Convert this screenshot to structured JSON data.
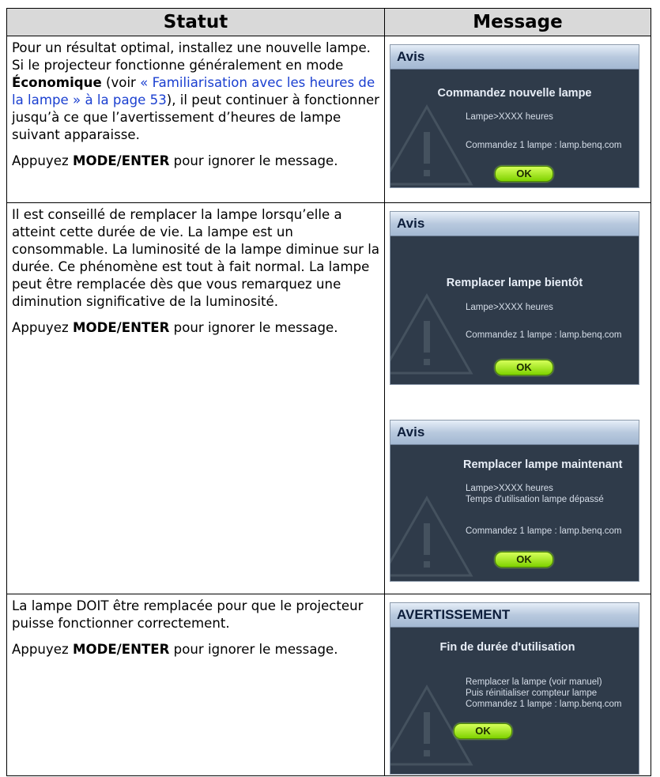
{
  "table": {
    "header_status": "Statut",
    "header_message": "Message"
  },
  "rows": [
    {
      "p1_a": "Pour un résultat optimal, installez une nouvelle lampe. Si le projecteur fonctionne généralement en mode ",
      "p1_bold": "Économique",
      "p1_b": " (voir ",
      "p1_link": "« Familiarisation avec les heures de la lampe » à la page 53",
      "p1_c": "), il peut continuer à fonctionner jusqu’à ce que l’avertissement d’heures de lampe suivant apparaisse.",
      "p2_a": "Appuyez ",
      "p2_bold": "MODE/ENTER",
      "p2_b": " pour ignorer le message."
    },
    {
      "p1": "Il est conseillé de remplacer la lampe lorsqu’elle a atteint cette durée de vie. La lampe est un consommable. La luminosité de la lampe diminue sur la durée. Ce phénomène est tout à fait normal. La lampe peut être remplacée dès que vous remarquez une diminution significative de la luminosité.",
      "p2_a": "Appuyez ",
      "p2_bold": "MODE/ENTER",
      "p2_b": " pour ignorer le message."
    },
    {
      "p1": "La lampe DOIT être remplacée pour que le projecteur puisse fonctionner correctement.",
      "p2_a": "Appuyez ",
      "p2_bold": "MODE/ENTER",
      "p2_b": " pour ignorer le message."
    }
  ],
  "osd": [
    {
      "bar": "Avis",
      "title": "Commandez nouvelle lampe",
      "line1": "Lampe>XXXX heures",
      "line2": "",
      "line3": "Commandez 1 lampe : lamp.benq.com",
      "ok": "OK"
    },
    {
      "bar": "Avis",
      "title": "Remplacer lampe bientôt",
      "line1": "Lampe>XXXX heures",
      "line2": "",
      "line3": "Commandez 1 lampe : lamp.benq.com",
      "ok": "OK"
    },
    {
      "bar": "Avis",
      "title": "Remplacer lampe maintenant",
      "line1": "Lampe>XXXX heures",
      "line2": "Temps d'utilisation lampe dépassé",
      "line3": "Commandez 1 lampe : lamp.benq.com",
      "ok": "OK"
    },
    {
      "bar": "AVERTISSEMENT",
      "title": "Fin de durée d'utilisation",
      "line1": "Remplacer la lampe (voir manuel)",
      "line2": "Puis réinitialiser compteur lampe",
      "line3": "Commandez 1 lampe : lamp.benq.com",
      "ok": "OK"
    }
  ],
  "colors": {
    "header_bg": "#d9d9d9",
    "link": "#1a3fd0",
    "osd_bg": "#2f3b4a",
    "ok_button": "#9be61a"
  },
  "icons": [
    "warning-triangle-icon"
  ]
}
